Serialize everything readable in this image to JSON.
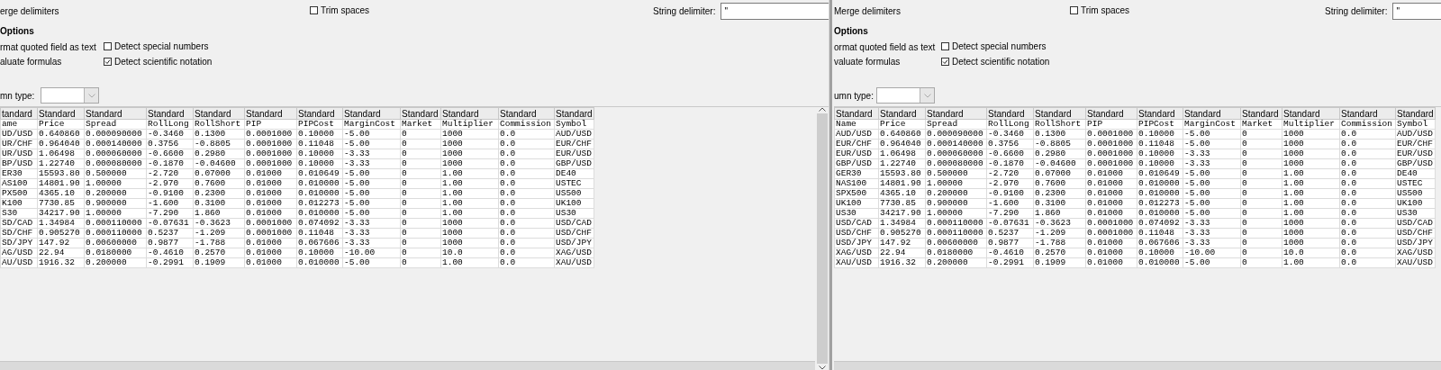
{
  "panels": [
    {
      "merge_delimiters": "erge delimiters",
      "trim_spaces": {
        "label": "Trim spaces",
        "checked": false
      },
      "string_delimiter": {
        "label": "String delimiter:",
        "value": "\""
      },
      "other_options": {
        "title": "Options",
        "format_quoted": "rmat quoted field as text",
        "evaluate_formulas": "aluate formulas",
        "detect_special_numbers": {
          "label": "Detect special numbers",
          "checked": false
        },
        "detect_scientific_notation": {
          "label": "Detect scientific notation",
          "checked": true
        }
      },
      "column_type": {
        "label": "mn type:"
      },
      "table": {
        "column_types": [
          "tandard",
          "Standard",
          "Standard",
          "Standard",
          "Standard",
          "Standard",
          "Standard",
          "Standard",
          "Standard",
          "Standard",
          "Standard",
          "Standard"
        ],
        "columns": [
          "ame",
          "Price",
          "Spread",
          "RollLong",
          "RollShort",
          "PIP",
          "PIPCost",
          "MarginCost",
          "Market",
          "Multiplier",
          "Commission",
          "Symbol"
        ],
        "rows": [
          [
            "UD/USD",
            "0.640860",
            "0.000090000",
            "-0.3460",
            "0.1300",
            "0.0001000",
            "0.10000",
            "-5.00",
            "0",
            "1000",
            "0.0",
            "AUD/USD"
          ],
          [
            "UR/CHF",
            "0.964040",
            "0.000140000",
            "0.3756",
            "-0.8805",
            "0.0001000",
            "0.11048",
            "-5.00",
            "0",
            "1000",
            "0.0",
            "EUR/CHF"
          ],
          [
            "UR/USD",
            "1.06498",
            "0.000060000",
            "-0.6600",
            "0.2980",
            "0.0001000",
            "0.10000",
            "-3.33",
            "0",
            "1000",
            "0.0",
            "EUR/USD"
          ],
          [
            "BP/USD",
            "1.22740",
            "0.000080000",
            "-0.1870",
            "-0.04600",
            "0.0001000",
            "0.10000",
            "-3.33",
            "0",
            "1000",
            "0.0",
            "GBP/USD"
          ],
          [
            "ER30",
            "15593.80",
            "0.500000",
            "-2.720",
            "0.07000",
            "0.01000",
            "0.010649",
            "-5.00",
            "0",
            "1.00",
            "0.0",
            "DE40"
          ],
          [
            "AS100",
            "14801.90",
            "1.00000",
            "-2.970",
            "0.7600",
            "0.01000",
            "0.010000",
            "-5.00",
            "0",
            "1.00",
            "0.0",
            "USTEC"
          ],
          [
            "PX500",
            "4365.10",
            "0.200000",
            "-0.9100",
            "0.2300",
            "0.01000",
            "0.010000",
            "-5.00",
            "0",
            "1.00",
            "0.0",
            "US500"
          ],
          [
            "K100",
            "7730.85",
            "0.900000",
            "-1.600",
            "0.3100",
            "0.01000",
            "0.012273",
            "-5.00",
            "0",
            "1.00",
            "0.0",
            "UK100"
          ],
          [
            "S30",
            "34217.90",
            "1.00000",
            "-7.290",
            "1.860",
            "0.01000",
            "0.010000",
            "-5.00",
            "0",
            "1.00",
            "0.0",
            "US30"
          ],
          [
            "SD/CAD",
            "1.34984",
            "0.000110000",
            "-0.07631",
            "-0.3623",
            "0.0001000",
            "0.074092",
            "-3.33",
            "0",
            "1000",
            "0.0",
            "USD/CAD"
          ],
          [
            "SD/CHF",
            "0.905270",
            "0.000110000",
            "0.5237",
            "-1.209",
            "0.0001000",
            "0.11048",
            "-3.33",
            "0",
            "1000",
            "0.0",
            "USD/CHF"
          ],
          [
            "SD/JPY",
            "147.92",
            "0.00600000",
            "0.9877",
            "-1.788",
            "0.01000",
            "0.067606",
            "-3.33",
            "0",
            "1000",
            "0.0",
            "USD/JPY"
          ],
          [
            "AG/USD",
            "22.94",
            "0.0180000",
            "-0.4610",
            "0.2570",
            "0.01000",
            "0.10000",
            "-10.00",
            "0",
            "10.0",
            "0.0",
            "XAG/USD"
          ],
          [
            "AU/USD",
            "1916.32",
            "0.200000",
            "-0.2991",
            "0.1909",
            "0.01000",
            "0.010000",
            "-5.00",
            "0",
            "1.00",
            "0.0",
            "XAU/USD"
          ]
        ]
      }
    },
    {
      "merge_delimiters": "Merge delimiters",
      "trim_spaces": {
        "label": "Trim spaces",
        "checked": false
      },
      "string_delimiter": {
        "label": "String delimiter:",
        "value": "\""
      },
      "other_options": {
        "title": "Options",
        "format_quoted": "ormat quoted field as text",
        "evaluate_formulas": "valuate formulas",
        "detect_special_numbers": {
          "label": "Detect special numbers",
          "checked": false
        },
        "detect_scientific_notation": {
          "label": "Detect scientific notation",
          "checked": true
        }
      },
      "column_type": {
        "label": "umn type:"
      },
      "table": {
        "column_types": [
          "Standard",
          "Standard",
          "Standard",
          "Standard",
          "Standard",
          "Standard",
          "Standard",
          "Standard",
          "Standard",
          "Standard",
          "Standard",
          "Standard"
        ],
        "columns": [
          "Name",
          "Price",
          "Spread",
          "RollLong",
          "RollShort",
          "PIP",
          "PIPCost",
          "MarginCost",
          "Market",
          "Multiplier",
          "Commission",
          "Symbol"
        ],
        "rows": [
          [
            "AUD/USD",
            "0.640860",
            "0.000090000",
            "-0.3460",
            "0.1300",
            "0.0001000",
            "0.10000",
            "-5.00",
            "0",
            "1000",
            "0.0",
            "AUD/USD"
          ],
          [
            "EUR/CHF",
            "0.964040",
            "0.000140000",
            "0.3756",
            "-0.8805",
            "0.0001000",
            "0.11048",
            "-5.00",
            "0",
            "1000",
            "0.0",
            "EUR/CHF"
          ],
          [
            "EUR/USD",
            "1.06498",
            "0.000060000",
            "-0.6600",
            "0.2980",
            "0.0001000",
            "0.10000",
            "-3.33",
            "0",
            "1000",
            "0.0",
            "EUR/USD"
          ],
          [
            "GBP/USD",
            "1.22740",
            "0.000080000",
            "-0.1870",
            "-0.04600",
            "0.0001000",
            "0.10000",
            "-3.33",
            "0",
            "1000",
            "0.0",
            "GBP/USD"
          ],
          [
            "GER30",
            "15593.80",
            "0.500000",
            "-2.720",
            "0.07000",
            "0.01000",
            "0.010649",
            "-5.00",
            "0",
            "1.00",
            "0.0",
            "DE40"
          ],
          [
            "NAS100",
            "14801.90",
            "1.00000",
            "-2.970",
            "0.7600",
            "0.01000",
            "0.010000",
            "-5.00",
            "0",
            "1.00",
            "0.0",
            "USTEC"
          ],
          [
            "SPX500",
            "4365.10",
            "0.200000",
            "-0.9100",
            "0.2300",
            "0.01000",
            "0.010000",
            "-5.00",
            "0",
            "1.00",
            "0.0",
            "US500"
          ],
          [
            "UK100",
            "7730.85",
            "0.900000",
            "-1.600",
            "0.3100",
            "0.01000",
            "0.012273",
            "-5.00",
            "0",
            "1.00",
            "0.0",
            "UK100"
          ],
          [
            "US30",
            "34217.90",
            "1.00000",
            "-7.290",
            "1.860",
            "0.01000",
            "0.010000",
            "-5.00",
            "0",
            "1.00",
            "0.0",
            "US30"
          ],
          [
            "USD/CAD",
            "1.34984",
            "0.000110000",
            "-0.07631",
            "-0.3623",
            "0.0001000",
            "0.074092",
            "-3.33",
            "0",
            "1000",
            "0.0",
            "USD/CAD"
          ],
          [
            "USD/CHF",
            "0.905270",
            "0.000110000",
            "0.5237",
            "-1.209",
            "0.0001000",
            "0.11048",
            "-3.33",
            "0",
            "1000",
            "0.0",
            "USD/CHF"
          ],
          [
            "USD/JPY",
            "147.92",
            "0.00600000",
            "0.9877",
            "-1.788",
            "0.01000",
            "0.067606",
            "-3.33",
            "0",
            "1000",
            "0.0",
            "USD/JPY"
          ],
          [
            "XAG/USD",
            "22.94",
            "0.0180000",
            "-0.4610",
            "0.2570",
            "0.01000",
            "0.10000",
            "-10.00",
            "0",
            "10.0",
            "0.0",
            "XAG/USD"
          ],
          [
            "XAU/USD",
            "1916.32",
            "0.200000",
            "-0.2991",
            "0.1909",
            "0.01000",
            "0.010000",
            "-5.00",
            "0",
            "1.00",
            "0.0",
            "XAU/USD"
          ]
        ]
      }
    }
  ]
}
